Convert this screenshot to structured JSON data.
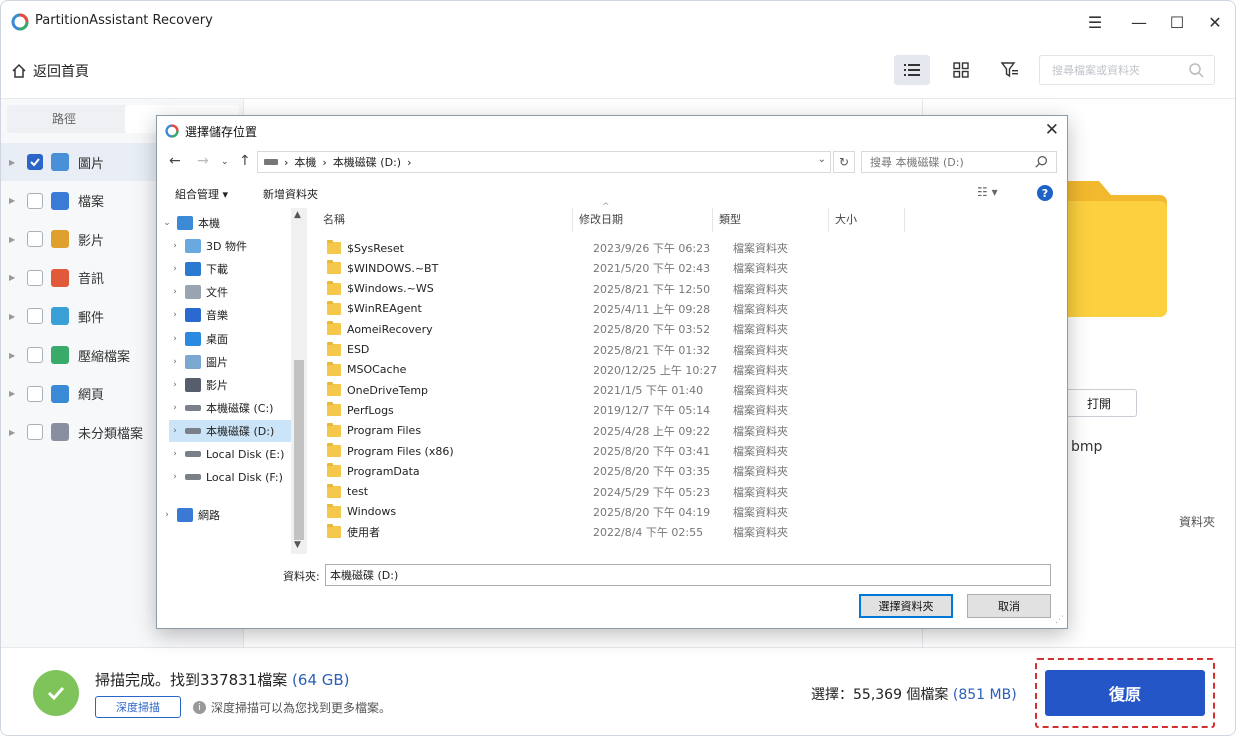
{
  "app": {
    "title": "PartitionAssistant Recovery",
    "window_buttons": [
      "☰",
      "—",
      "☐",
      "✕"
    ]
  },
  "header": {
    "back_label": "返回首頁",
    "search_placeholder": "搜尋檔案或資料夾"
  },
  "left": {
    "tabs": [
      "路徑",
      ""
    ],
    "categories": [
      {
        "label": "圖片",
        "checked": true,
        "icon": "image-icon",
        "color": "#4a90d9"
      },
      {
        "label": "檔案",
        "checked": false,
        "icon": "document-icon",
        "color": "#3a7bd5"
      },
      {
        "label": "影片",
        "checked": false,
        "icon": "video-icon",
        "color": "#e0a030"
      },
      {
        "label": "音訊",
        "checked": false,
        "icon": "music-icon",
        "color": "#e05a3a"
      },
      {
        "label": "郵件",
        "checked": false,
        "icon": "mail-icon",
        "color": "#3aa0d5"
      },
      {
        "label": "壓縮檔案",
        "checked": false,
        "icon": "archive-icon",
        "color": "#3aaa6a"
      },
      {
        "label": "網頁",
        "checked": false,
        "icon": "web-icon",
        "color": "#3a8ad5"
      },
      {
        "label": "未分類檔案",
        "checked": false,
        "icon": "question-icon",
        "color": "#8a8fa0"
      }
    ]
  },
  "right": {
    "open_label": "打開",
    "file_ext": "bmp",
    "type_label": "資料夾"
  },
  "bottom": {
    "scan_done_prefix": "掃描完成。找到337831檔案",
    "scan_done_size": "(64 GB)",
    "deep_scan_label": "深度掃描",
    "hint": "深度掃描可以為您找到更多檔案。",
    "selection_prefix": "選擇：55,369 個檔案",
    "selection_size": "(851 MB)",
    "recover_label": "復原"
  },
  "dialog": {
    "title": "選擇儲存位置",
    "address": [
      "本機",
      "本機磁碟 (D:)"
    ],
    "search_placeholder": "搜尋 本機磁碟 (D:)",
    "organize_label": "組合管理 ▾",
    "new_folder_label": "新增資料夾",
    "tree": [
      {
        "label": "本機",
        "icon": "computer-icon",
        "indent": 0,
        "caret": "⌄"
      },
      {
        "label": "3D 物件",
        "icon": "cube-icon",
        "indent": 1,
        "caret": "›"
      },
      {
        "label": "下載",
        "icon": "download-icon",
        "indent": 1,
        "caret": "›"
      },
      {
        "label": "文件",
        "icon": "document-icon",
        "indent": 1,
        "caret": "›"
      },
      {
        "label": "音樂",
        "icon": "music-icon",
        "indent": 1,
        "caret": "›"
      },
      {
        "label": "桌面",
        "icon": "desktop-icon",
        "indent": 1,
        "caret": "›"
      },
      {
        "label": "圖片",
        "icon": "image-icon",
        "indent": 1,
        "caret": "›"
      },
      {
        "label": "影片",
        "icon": "video-icon",
        "indent": 1,
        "caret": "›"
      },
      {
        "label": "本機磁碟 (C:)",
        "icon": "drive-icon",
        "indent": 1,
        "caret": "›"
      },
      {
        "label": "本機磁碟 (D:)",
        "icon": "drive-icon",
        "indent": 1,
        "caret": "›",
        "selected": true
      },
      {
        "label": "Local Disk (E:)",
        "icon": "drive-icon",
        "indent": 1,
        "caret": "›"
      },
      {
        "label": "Local Disk (F:)",
        "icon": "drive-icon",
        "indent": 1,
        "caret": "›"
      },
      {
        "label": "網路",
        "icon": "network-icon",
        "indent": 0,
        "caret": "›"
      }
    ],
    "columns": [
      "名稱",
      "修改日期",
      "類型",
      "大小"
    ],
    "files": [
      {
        "name": "$SysReset",
        "date": "2023/9/26 下午 06:23",
        "type": "檔案資料夾"
      },
      {
        "name": "$WINDOWS.~BT",
        "date": "2021/5/20 下午 02:43",
        "type": "檔案資料夾"
      },
      {
        "name": "$Windows.~WS",
        "date": "2025/8/21 下午 12:50",
        "type": "檔案資料夾"
      },
      {
        "name": "$WinREAgent",
        "date": "2025/4/11 上午 09:28",
        "type": "檔案資料夾"
      },
      {
        "name": "AomeiRecovery",
        "date": "2025/8/20 下午 03:52",
        "type": "檔案資料夾"
      },
      {
        "name": "ESD",
        "date": "2025/8/21 下午 01:32",
        "type": "檔案資料夾"
      },
      {
        "name": "MSOCache",
        "date": "2020/12/25 上午 10:27",
        "type": "檔案資料夾"
      },
      {
        "name": "OneDriveTemp",
        "date": "2021/1/5 下午 01:40",
        "type": "檔案資料夾"
      },
      {
        "name": "PerfLogs",
        "date": "2019/12/7 下午 05:14",
        "type": "檔案資料夾"
      },
      {
        "name": "Program Files",
        "date": "2025/4/28 上午 09:22",
        "type": "檔案資料夾"
      },
      {
        "name": "Program Files (x86)",
        "date": "2025/8/20 下午 03:41",
        "type": "檔案資料夾"
      },
      {
        "name": "ProgramData",
        "date": "2025/8/20 下午 03:35",
        "type": "檔案資料夾"
      },
      {
        "name": "test",
        "date": "2024/5/29 下午 05:23",
        "type": "檔案資料夾"
      },
      {
        "name": "Windows",
        "date": "2025/8/20 下午 04:19",
        "type": "檔案資料夾"
      },
      {
        "name": "使用者",
        "date": "2022/8/4 下午 02:55",
        "type": "檔案資料夾"
      }
    ],
    "folder_label": "資料夾:",
    "folder_value": "本機磁碟 (D:)",
    "select_folder_label": "選擇資料夾",
    "cancel_label": "取消"
  }
}
